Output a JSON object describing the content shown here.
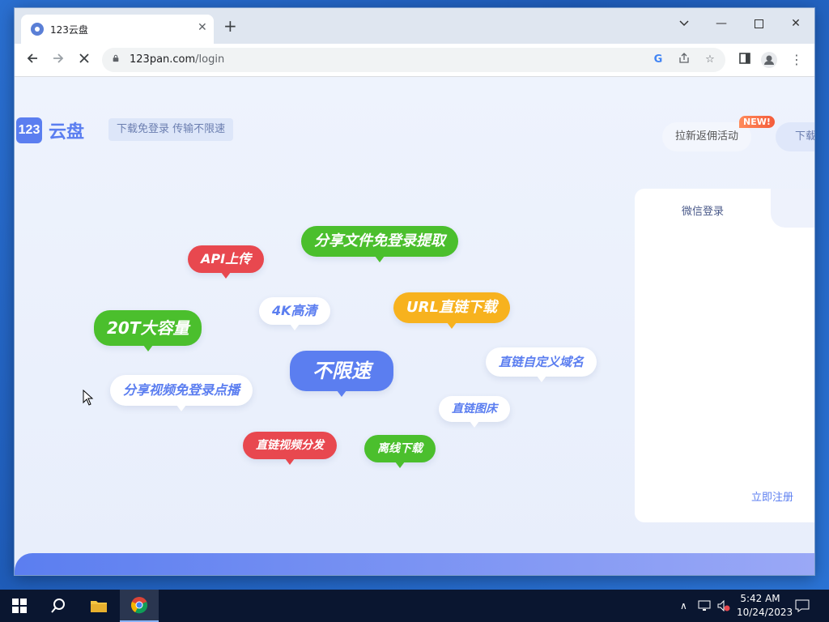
{
  "browser": {
    "tab_title": "123云盘",
    "url_host": "123pan.com",
    "url_path": "/login"
  },
  "page": {
    "logo_badge": "123",
    "logo_text": "云盘",
    "slogan": "下载免登录 传输不限速",
    "promo_label": "拉新返佣活动",
    "new_badge": "NEW!",
    "download_label": "下载"
  },
  "bubbles": [
    {
      "text": "分享文件免登录提取"
    },
    {
      "text": "API上传"
    },
    {
      "text": "4K高清"
    },
    {
      "text": "URL直链下载"
    },
    {
      "text": "20T大容量"
    },
    {
      "text": "直链自定义域名"
    },
    {
      "text": "不限速"
    },
    {
      "text": "分享视频免登录点播"
    },
    {
      "text": "直链图床"
    },
    {
      "text": "直链视频分发"
    },
    {
      "text": "离线下载"
    }
  ],
  "login": {
    "tab_wechat": "微信登录",
    "register": "立即注册"
  },
  "taskbar": {
    "time": "5:42 AM",
    "date": "10/24/2023"
  },
  "colors": {
    "brand": "#5b7ef0",
    "green": "#4bbf2d",
    "red": "#e8484f",
    "orange": "#f7b21e"
  }
}
